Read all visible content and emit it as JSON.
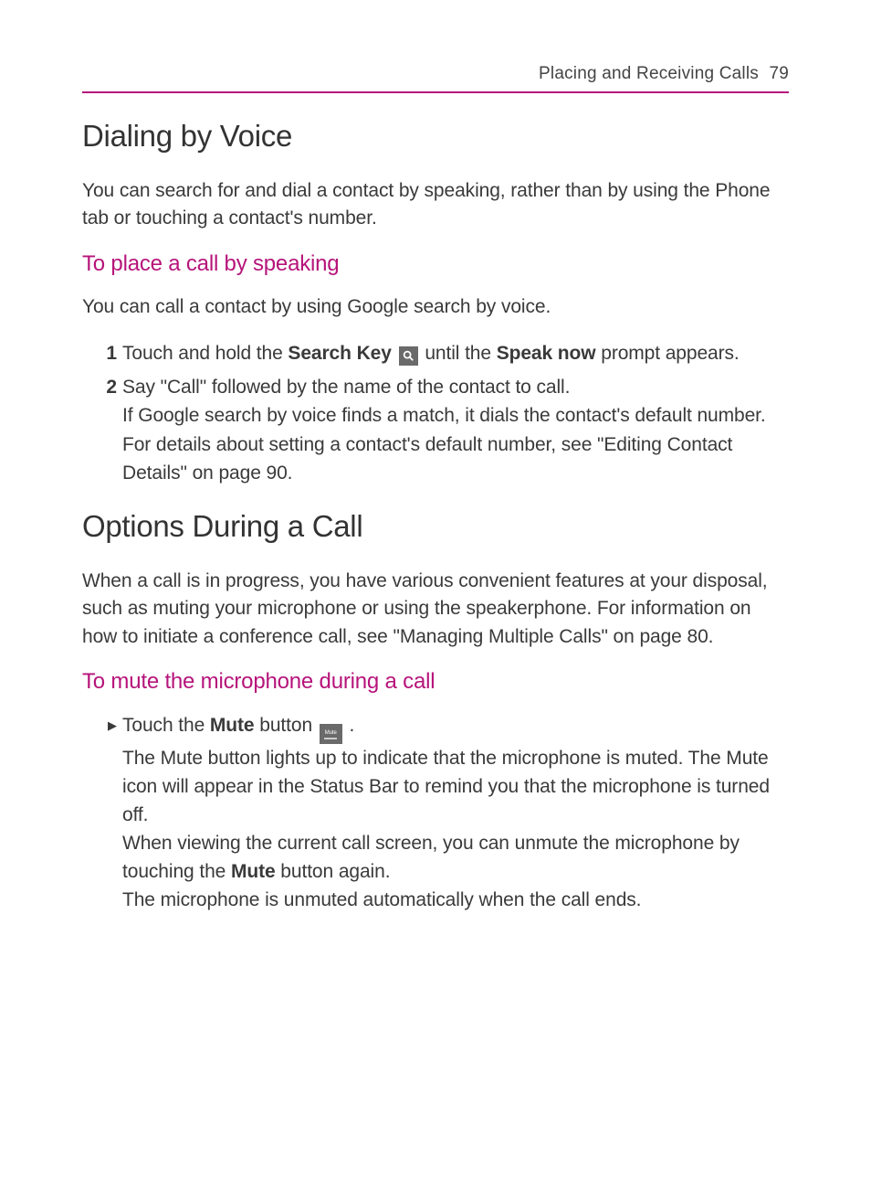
{
  "header": {
    "chapter": "Placing and Receiving Calls",
    "page_number": "79"
  },
  "sections": [
    {
      "heading": "Dialing by Voice",
      "intro": "You can search for and dial a contact by speaking, rather than by using the Phone tab or touching a contact's number.",
      "sub_heading": "To place a call by speaking",
      "sub_intro": "You can call a contact by using Google search by voice.",
      "steps": [
        {
          "n": "1",
          "t_before": "Touch and hold the ",
          "bold1": "Search Key",
          "t_mid": " until the ",
          "bold2": "Speak now",
          "t_after": " prompt appears."
        },
        {
          "n": "2",
          "line1": "Say \"Call\" followed by the name of the contact to call.",
          "line2": "If Google search by voice finds a match, it dials the contact's default number.",
          "line3": "For details about setting a contact's default number, see \"Editing Contact Details\" on page 90."
        }
      ]
    },
    {
      "heading": "Options During a Call",
      "intro": "When a call is in progress, you have various convenient features at your disposal, such as muting your microphone or using the speakerphone. For information on how to initiate a conference call, see \"Managing Multiple Calls\" on page 80.",
      "sub_heading": "To mute the microphone during a call",
      "bullet": {
        "l1_before": "Touch the ",
        "l1_bold": "Mute",
        "l1_after_icon": " button ",
        "l1_end": " .",
        "l2": "The Mute button lights up to indicate that the microphone is muted. The Mute icon will appear in the Status Bar to remind you that the microphone is turned off.",
        "l3_before": "When viewing the current call screen, you can unmute the microphone by touching the ",
        "l3_bold": "Mute",
        "l3_after": " button again.",
        "l4": "The microphone is unmuted automatically when the call ends."
      }
    }
  ],
  "icons": {
    "mute_label": "Mute"
  }
}
